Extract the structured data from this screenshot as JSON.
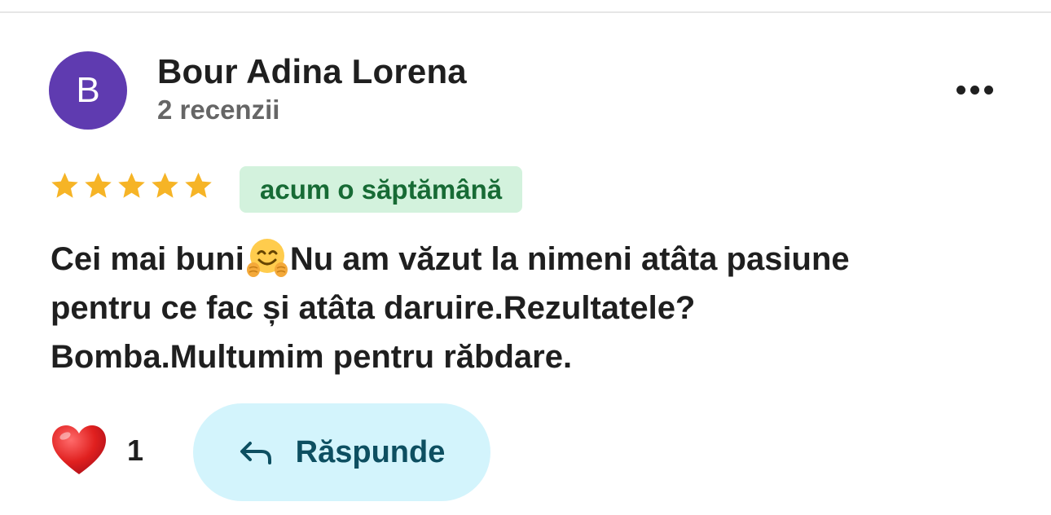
{
  "review": {
    "author": {
      "initial": "B",
      "name": "Bour Adina Lorena",
      "review_count": "2 recenzii"
    },
    "menu_icon": "more-horizontal-icon",
    "rating": 5,
    "rating_max": 5,
    "time_ago": "acum o săptămână",
    "text": {
      "part1": "Cei mai buni",
      "emoji": "hugging-face-emoji",
      "part2": "Nu am văzut la nimeni atâta pasiune pentru ce fac și atâta daruire.Rezultatele? Bomba.Multumim pentru răbdare."
    },
    "reaction": {
      "icon": "red-heart-icon",
      "count": "1"
    },
    "reply": {
      "icon": "reply-arrow-icon",
      "label": "Răspunde"
    }
  },
  "colors": {
    "avatar_bg": "#5f3bb0",
    "star": "#f6b426",
    "badge_bg": "#d3f2dd",
    "badge_text": "#176b35",
    "reply_bg": "#d3f4fc",
    "reply_text": "#0d4f61",
    "heart": "#e02424"
  }
}
